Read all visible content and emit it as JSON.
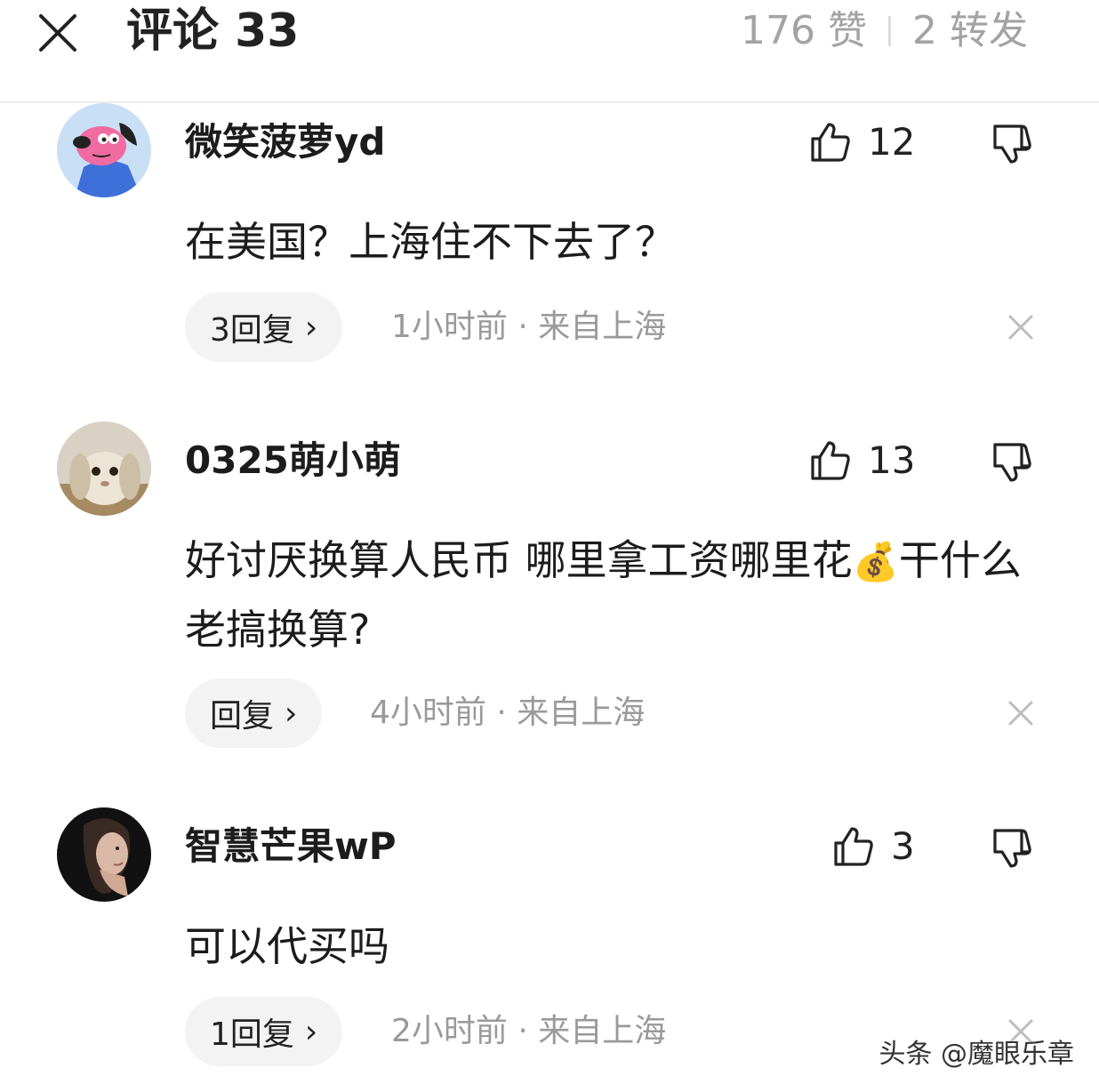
{
  "header": {
    "title": "评论 33",
    "likes_text": "176 赞",
    "reposts_text": "2 转发"
  },
  "comments": [
    {
      "username": "微笑菠萝yd",
      "like_count": "12",
      "text": "在美国？上海住不下去了？",
      "reply_label": "3回复",
      "meta": "1小时前 · 来自上海",
      "avatar": "cartoon-pink-dog-avatar"
    },
    {
      "username": "0325萌小萌",
      "like_count": "13",
      "text_before_emoji": "好讨厌换算人民币 哪里拿工资哪里花",
      "emoji": "💰",
      "text_after_emoji": "干什么老搞换算?",
      "reply_label": "回复",
      "meta": "4小时前 · 来自上海",
      "avatar": "rabbit-photo-avatar"
    },
    {
      "username": "智慧芒果wP",
      "like_count": "3",
      "text": "可以代买吗",
      "reply_label": "1回复",
      "meta": "2小时前 · 来自上海",
      "avatar": "woman-portrait-avatar"
    }
  ],
  "watermark": "头条 @魔眼乐章",
  "icons": {
    "close": "close-icon",
    "like": "thumbs-up-icon",
    "dislike": "thumbs-down-icon",
    "remove": "close-small-icon",
    "chevron": "chevron-right-icon"
  }
}
